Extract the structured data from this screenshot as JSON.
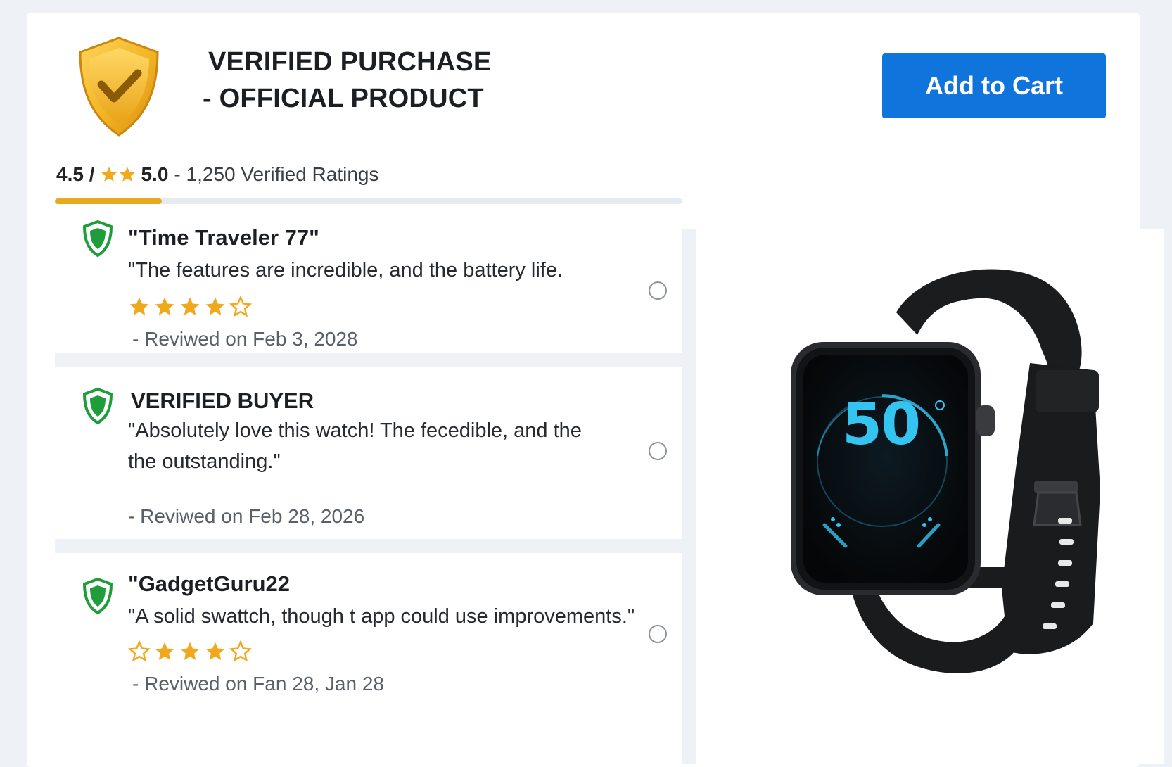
{
  "header": {
    "title_line1": "VERIFIED PURCHASE",
    "title_line2": "- OFFICIAL PRODUCT",
    "cart_button_label": "Add to Cart",
    "badge_icon": "shield-check-icon"
  },
  "rating": {
    "score": "4.5 /",
    "max": "5.0",
    "count_text": "- 1,250 Verified Ratings",
    "progress_fraction": 0.17
  },
  "reviews": [
    {
      "name": "\"Time Traveler 77\"",
      "text": "\"The features are incredible, and the battery life.",
      "stars": [
        "full",
        "full",
        "full",
        "full",
        "outline"
      ],
      "date": "- Reviwed on Feb 3, 2028"
    },
    {
      "name": "VERIFIED BUYER",
      "text": "\"Absolutely love this watch! The fecedible, and the the outstanding.\"",
      "stars": [],
      "date": "- Reviwed on Feb 28, 2026"
    },
    {
      "name": "\"GadgetGuru22",
      "text": "\"A solid swattch, though t app could use improvements.\"",
      "stars": [
        "outline",
        "full",
        "full",
        "full",
        "outline"
      ],
      "date": "- Reviwed on Fan 28, Jan 28"
    }
  ],
  "product": {
    "watch_display": "50"
  },
  "colors": {
    "accent_blue": "#0f74dc",
    "star_gold": "#f0a81c",
    "shield_green": "#1f9d3a",
    "progress_gold": "#e7aa1f"
  }
}
